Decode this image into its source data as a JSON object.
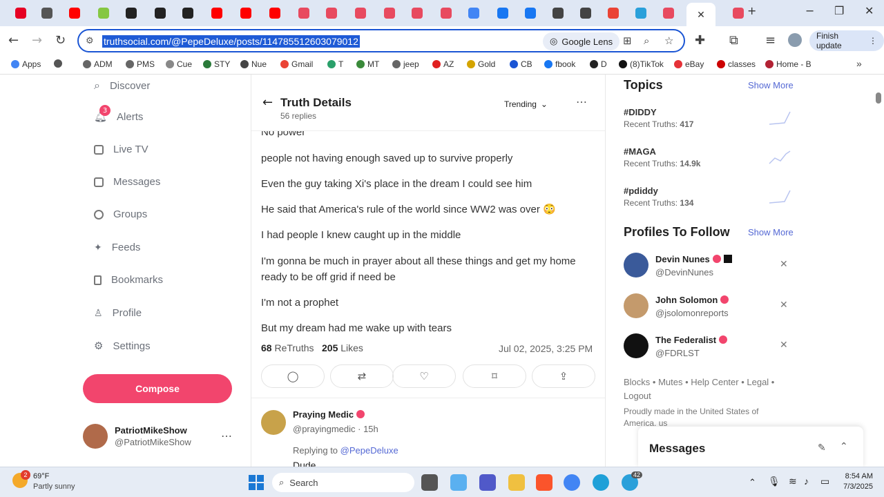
{
  "tabs": [
    {
      "icon": "pinterest-icon",
      "color": "#e60023"
    },
    {
      "icon": "chrome-icon",
      "color": "#555"
    },
    {
      "icon": "youtube-icon",
      "color": "#ff0000"
    },
    {
      "icon": "rumble-icon",
      "color": "#85c742"
    },
    {
      "icon": "dots-app-icon",
      "color": "#222"
    },
    {
      "icon": "dots-app-icon",
      "color": "#222"
    },
    {
      "icon": "dots-app-icon",
      "color": "#222"
    },
    {
      "icon": "youtube-icon",
      "color": "#ff0000"
    },
    {
      "icon": "youtube-icon",
      "color": "#ff0000"
    },
    {
      "icon": "youtube-icon",
      "color": "#ff0000"
    },
    {
      "icon": "truth-social-icon",
      "color": "#e84a5f"
    },
    {
      "icon": "truth-social-icon",
      "color": "#e84a5f"
    },
    {
      "icon": "truth-social-icon",
      "color": "#e84a5f"
    },
    {
      "icon": "truth-social-icon",
      "color": "#e84a5f"
    },
    {
      "icon": "truth-social-icon",
      "color": "#e84a5f"
    },
    {
      "icon": "truth-social-icon",
      "color": "#e84a5f"
    },
    {
      "icon": "google-icon",
      "color": "#4285f4"
    },
    {
      "icon": "facebook-icon",
      "color": "#1877f2"
    },
    {
      "icon": "facebook-icon",
      "color": "#1877f2"
    },
    {
      "icon": "newsmax-icon",
      "color": "#444"
    },
    {
      "icon": "newsmax-icon",
      "color": "#444"
    },
    {
      "icon": "gmail-icon",
      "color": "#ea4335"
    },
    {
      "icon": "telegram-icon",
      "color": "#2aa0da"
    },
    {
      "icon": "truth-social-icon",
      "color": "#e84a5f"
    }
  ],
  "url": "truthsocial.com/@PepeDeluxe/posts/114785512603079012",
  "lens_label": "Google Lens",
  "finish_update": "Finish update",
  "bookmarks": [
    {
      "label": "Apps",
      "color": "#4285f4"
    },
    {
      "label": "",
      "color": "#555"
    },
    {
      "label": "ADM",
      "color": "#666"
    },
    {
      "label": "PMS",
      "color": "#666"
    },
    {
      "label": "Cue",
      "color": "#888"
    },
    {
      "label": "STY",
      "color": "#2a7a3a"
    },
    {
      "label": "Nue",
      "color": "#444"
    },
    {
      "label": "Gmail",
      "color": "#ea4335"
    },
    {
      "label": "T",
      "color": "#2aa06a"
    },
    {
      "label": "MT",
      "color": "#3a8a3a"
    },
    {
      "label": "jeep",
      "color": "#666"
    },
    {
      "label": "AZ",
      "color": "#e02020"
    },
    {
      "label": "Gold",
      "color": "#d4a400"
    },
    {
      "label": "CB",
      "color": "#1a55d4"
    },
    {
      "label": "fbook",
      "color": "#1877f2"
    },
    {
      "label": "D",
      "color": "#222"
    },
    {
      "label": "(8)TikTok",
      "color": "#111"
    },
    {
      "label": "eBay",
      "color": "#e53238"
    },
    {
      "label": "classes",
      "color": "#c00"
    },
    {
      "label": "Home - B",
      "color": "#b22234"
    }
  ],
  "nav": {
    "discover": "Discover",
    "alerts": "Alerts",
    "alerts_badge": "3",
    "livetv": "Live TV",
    "messages": "Messages",
    "groups": "Groups",
    "feeds": "Feeds",
    "bookmarks": "Bookmarks",
    "profile": "Profile",
    "settings": "Settings",
    "compose": "Compose",
    "user_name": "PatriotMikeShow",
    "user_handle": "@PatriotMikeShow"
  },
  "post": {
    "title": "Truth Details",
    "replies": "56 replies",
    "sort": "Trending",
    "lines": [
      "No power",
      "people not having enough saved up to survive properly",
      "Even the guy taking Xi's place in the dream I could see him",
      "He said that America's rule of the world since WW2 was over 😳",
      "I had people I knew caught up in the middle",
      "I'm gonna be much in prayer about all these things and get my home ready to be off grid if need be",
      "I'm not a prophet",
      "But my dream had me wake up with tears"
    ],
    "retruths_count": "68",
    "retruths_label": "ReTruths",
    "likes_count": "205",
    "likes_label": "Likes",
    "date": "Jul 02, 2025, 3:25 PM"
  },
  "reply": {
    "name": "Praying Medic",
    "handle": "@prayingmedic · 15h",
    "replying_prefix": "Replying to",
    "replying_to": "@PepeDeluxe",
    "text": "Dude"
  },
  "topics": {
    "heading": "Topics",
    "show_more": "Show More",
    "items": [
      {
        "tag": "#DIDDY",
        "count_label": "Recent Truths:",
        "count": "417"
      },
      {
        "tag": "#MAGA",
        "count_label": "Recent Truths:",
        "count": "14.9k"
      },
      {
        "tag": "#pdiddy",
        "count_label": "Recent Truths:",
        "count": "134"
      }
    ]
  },
  "follow": {
    "heading": "Profiles To Follow",
    "show_more": "Show More",
    "items": [
      {
        "name": "Devin Nunes",
        "handle": "@DevinNunes",
        "color": "#3a5a9a"
      },
      {
        "name": "John Solomon",
        "handle": "@jsolomonreports",
        "color": "#c49a6c"
      },
      {
        "name": "The Federalist",
        "handle": "@FDRLST",
        "color": "#111"
      }
    ]
  },
  "footer": {
    "links": "Blocks • Mutes • Help Center • Legal •",
    "logout": "Logout",
    "made": "Proudly made in the United States of America.",
    "us": "us"
  },
  "messages_dock": "Messages",
  "taskbar": {
    "weather_badge": "2",
    "temp": "69°F",
    "condition": "Partly sunny",
    "search": "Search",
    "telegram_badge": "42",
    "time": "8:54 AM",
    "date": "7/3/2025"
  }
}
